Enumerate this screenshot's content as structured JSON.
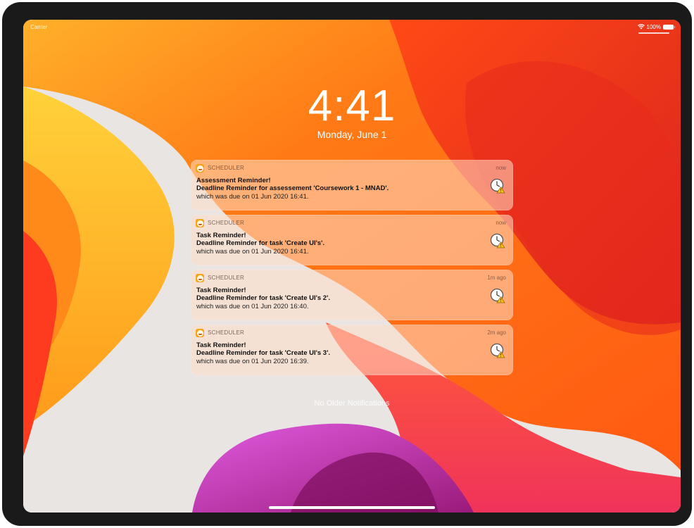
{
  "status_bar": {
    "carrier": "Carrier",
    "battery": "100%"
  },
  "lock_screen": {
    "time": "4:41",
    "date": "Monday, June 1",
    "no_older_notifications": "No Older Notifications"
  },
  "notifications": [
    {
      "app": "SCHEDULER",
      "time": "now",
      "title": "Assessment Reminder!",
      "subtitle": "Deadline Reminder for assessement 'Coursework 1 - MNAD'.",
      "body": "which was due on 01 Jun 2020 16:41."
    },
    {
      "app": "SCHEDULER",
      "time": "now",
      "title": "Task Reminder!",
      "subtitle": "Deadline Reminder for task 'Create UI's'.",
      "body": "which was due on 01 Jun 2020 16:41."
    },
    {
      "app": "SCHEDULER",
      "time": "1m ago",
      "title": "Task Reminder!",
      "subtitle": "Deadline Reminder for task 'Create UI's 2'.",
      "body": "which was due on 01 Jun 2020 16:40."
    },
    {
      "app": "SCHEDULER",
      "time": "2m ago",
      "title": "Task Reminder!",
      "subtitle": "Deadline Reminder for task 'Create UI's 3'.",
      "body": "which was due on 01 Jun 2020 16:39."
    }
  ],
  "icons": {
    "app_icon": "scheduler-app-icon",
    "thumbnail": "clock-warning-icon",
    "wifi": "wifi-icon",
    "battery": "battery-icon"
  },
  "colors": {
    "notification_bg": "#ffdec8",
    "device_frame": "#1a1a1a",
    "wallpaper_orange": "#ff6a13",
    "wallpaper_red": "#e8321e",
    "wallpaper_magenta": "#d4308c"
  }
}
